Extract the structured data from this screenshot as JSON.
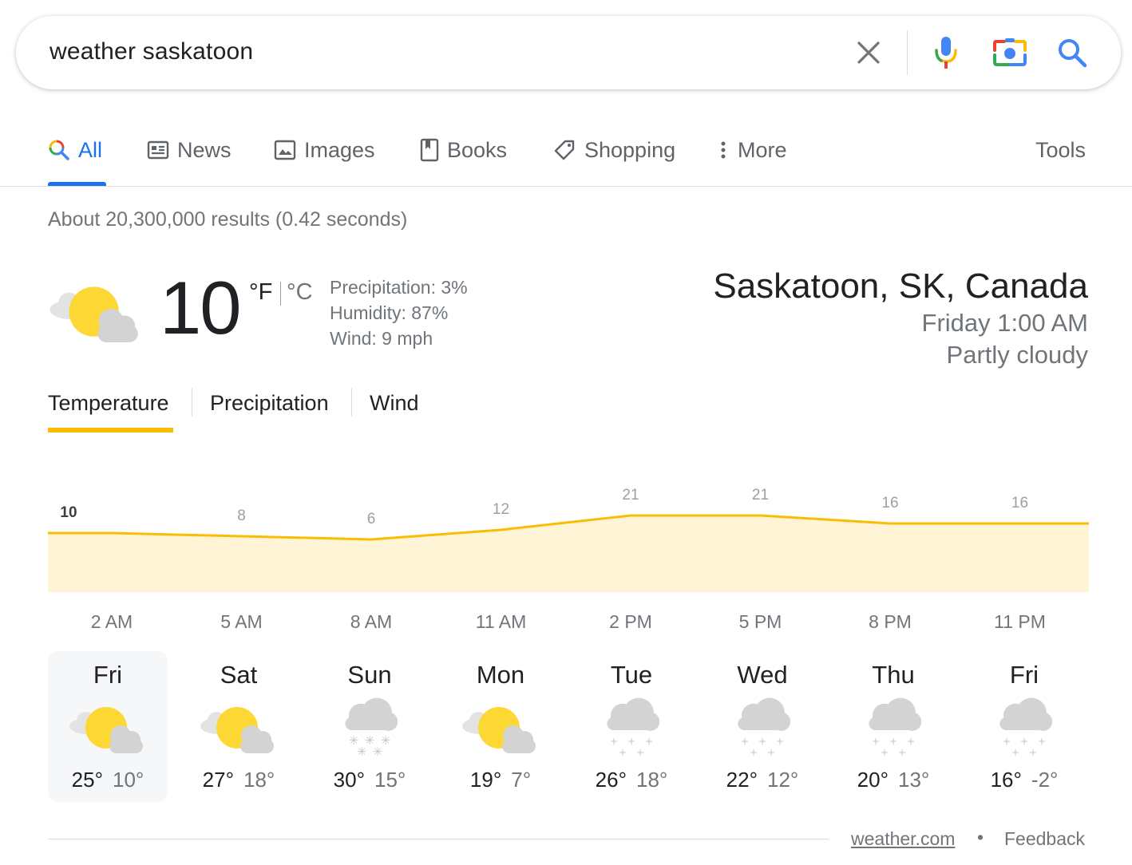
{
  "search": {
    "query": "weather saskatoon"
  },
  "tabs": [
    {
      "label": "All",
      "icon": "google-search-icon"
    },
    {
      "label": "News",
      "icon": "news-icon"
    },
    {
      "label": "Images",
      "icon": "image-icon"
    },
    {
      "label": "Books",
      "icon": "book-icon"
    },
    {
      "label": "Shopping",
      "icon": "tag-icon"
    },
    {
      "label": "More",
      "icon": "more-vert-icon"
    }
  ],
  "tools_label": "Tools",
  "result_stats": "About 20,300,000 results (0.42 seconds)",
  "weather": {
    "current_temp": "10",
    "unit_f": "°F",
    "unit_c": "°C",
    "precipitation": "Precipitation: 3%",
    "humidity": "Humidity: 87%",
    "wind": "Wind: 9 mph",
    "location": "Saskatoon, SK, Canada",
    "datetime": "Friday 1:00 AM",
    "condition": "Partly cloudy",
    "chart_tabs": [
      "Temperature",
      "Precipitation",
      "Wind"
    ],
    "active_chart_tab": "Temperature"
  },
  "chart_data": {
    "type": "area",
    "x": [
      "2 AM",
      "5 AM",
      "8 AM",
      "11 AM",
      "2 PM",
      "5 PM",
      "8 PM",
      "11 PM"
    ],
    "values": [
      10,
      8,
      6,
      12,
      21,
      21,
      16,
      16
    ],
    "data_labels": [
      "10",
      "8",
      "6",
      "12",
      "21",
      "21",
      "16",
      "16"
    ],
    "ylim": [
      -40,
      40
    ],
    "color": "#fbbc04",
    "fill": "#fff5d6",
    "grid": false
  },
  "forecast": [
    {
      "day": "Fri",
      "hi": "25°",
      "lo": "10°",
      "icon": "partly-cloudy-icon",
      "selected": true
    },
    {
      "day": "Sat",
      "hi": "27°",
      "lo": "18°",
      "icon": "partly-cloudy-icon"
    },
    {
      "day": "Sun",
      "hi": "30°",
      "lo": "15°",
      "icon": "snow-icon"
    },
    {
      "day": "Mon",
      "hi": "19°",
      "lo": "7°",
      "icon": "partly-cloudy-icon"
    },
    {
      "day": "Tue",
      "hi": "26°",
      "lo": "18°",
      "icon": "light-snow-icon"
    },
    {
      "day": "Wed",
      "hi": "22°",
      "lo": "12°",
      "icon": "light-snow-icon"
    },
    {
      "day": "Thu",
      "hi": "20°",
      "lo": "13°",
      "icon": "light-snow-icon"
    },
    {
      "day": "Fri",
      "hi": "16°",
      "lo": "-2°",
      "icon": "light-snow-icon"
    }
  ],
  "footer": {
    "source": "weather.com",
    "separator": "•",
    "feedback": "Feedback"
  },
  "colors": {
    "accent": "#1a73e8",
    "chart_line": "#fbbc04",
    "chart_fill": "#fff5d6",
    "sun": "#fdd835",
    "cloud": "#d3d3d3"
  }
}
